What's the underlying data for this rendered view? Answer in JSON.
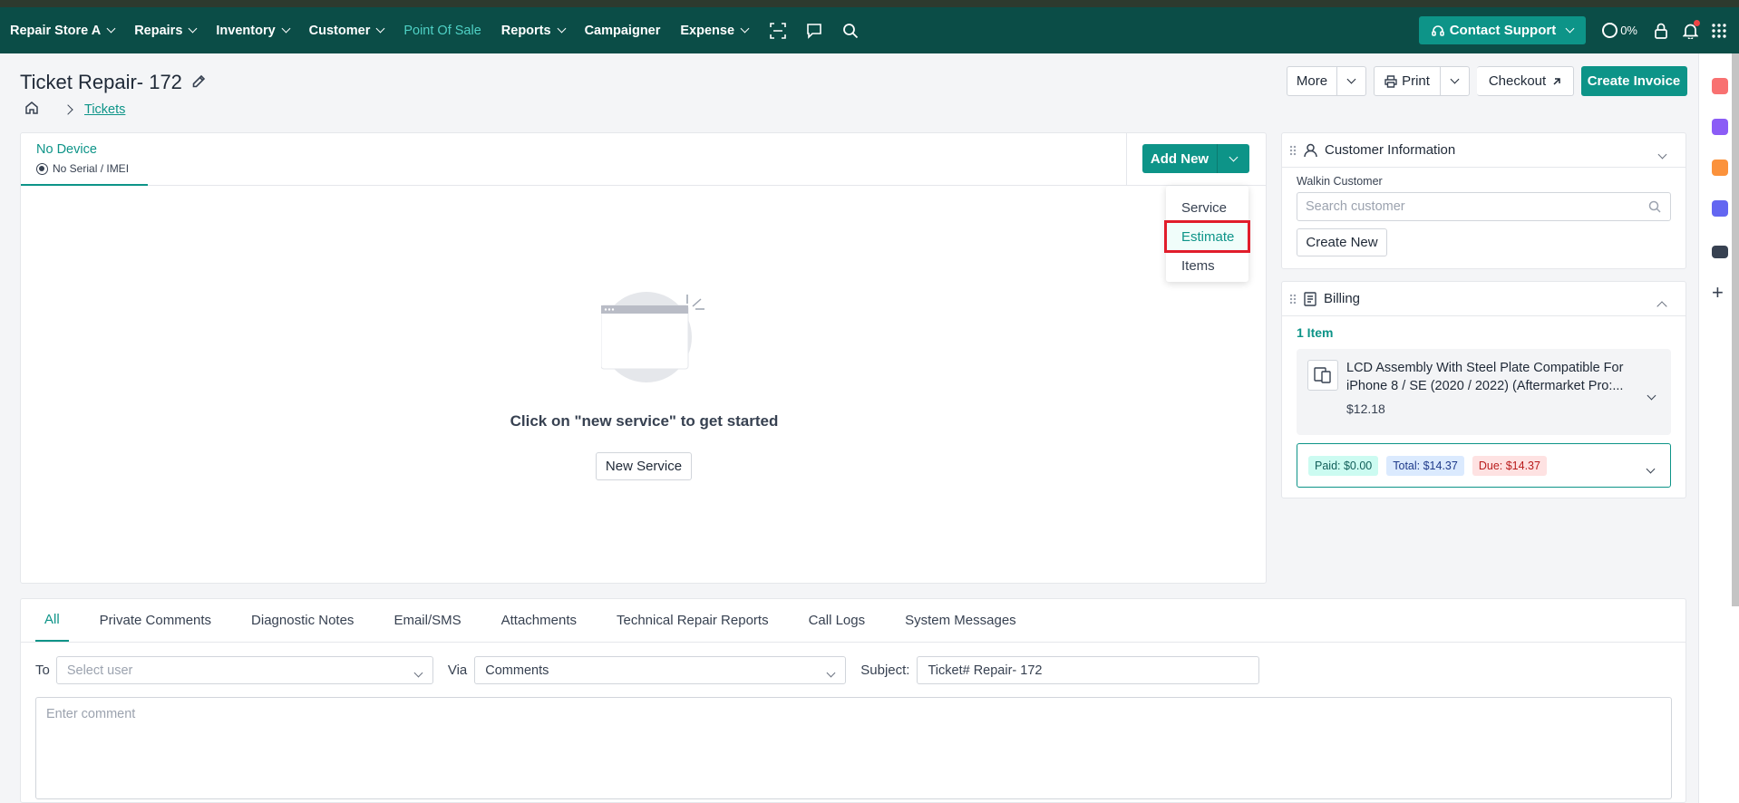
{
  "nav": {
    "items": [
      "Repair Store A",
      "Repairs",
      "Inventory",
      "Customer",
      "Point Of Sale",
      "Reports",
      "Campaigner",
      "Expense"
    ],
    "support_label": "Contact Support",
    "progress": "0%"
  },
  "header": {
    "title": "Ticket Repair- 172",
    "breadcrumb": "Tickets",
    "more": "More",
    "print": "Print",
    "checkout": "Checkout",
    "create_invoice": "Create Invoice"
  },
  "device": {
    "name": "No Device",
    "serial": "No Serial / IMEI",
    "add_new": "Add New",
    "menu": [
      "Service",
      "Estimate",
      "Items"
    ]
  },
  "empty": {
    "message": "Click on \"new service\" to get started",
    "button": "New Service"
  },
  "customer": {
    "title": "Customer Information",
    "walkin": "Walkin Customer",
    "search_placeholder": "Search customer",
    "create_new": "Create New"
  },
  "billing": {
    "title": "Billing",
    "count": "1 Item",
    "item_name": "LCD Assembly With Steel Plate Compatible For iPhone 8 / SE (2020 / 2022) (Aftermarket Pro:...",
    "item_price": "$12.18",
    "paid": "Paid: $0.00",
    "total": "Total: $14.37",
    "due": "Due: $14.37"
  },
  "comments": {
    "tabs": [
      "All",
      "Private Comments",
      "Diagnostic Notes",
      "Email/SMS",
      "Attachments",
      "Technical Repair Reports",
      "Call Logs",
      "System Messages"
    ],
    "to_label": "To",
    "to_placeholder": "Select user",
    "via_label": "Via",
    "via_value": "Comments",
    "subject_label": "Subject:",
    "subject_value": "Ticket# Repair- 172",
    "comment_placeholder": "Enter comment"
  },
  "colors": {
    "brand": "#0b4d47",
    "accent": "#0d9488",
    "highlight": "#e11d2b"
  }
}
